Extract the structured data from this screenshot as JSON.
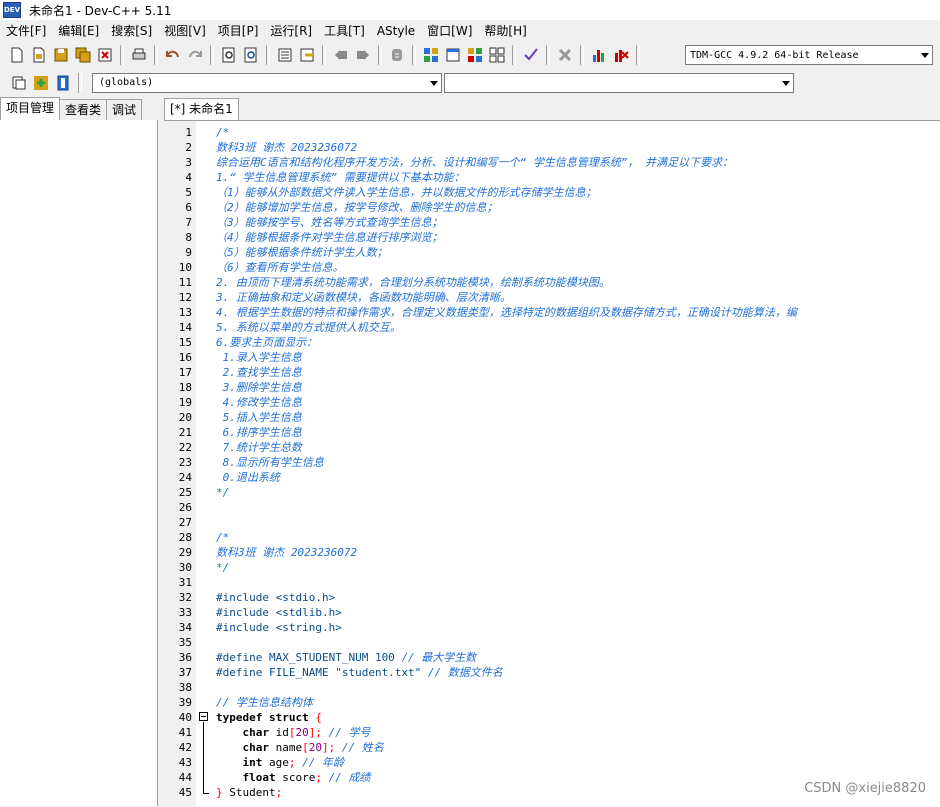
{
  "window": {
    "title": "未命名1 - Dev-C++ 5.11",
    "icon_text": "DEV"
  },
  "menu": [
    "文件[F]",
    "编辑[E]",
    "搜索[S]",
    "视图[V]",
    "项目[P]",
    "运行[R]",
    "工具[T]",
    "AStyle",
    "窗口[W]",
    "帮助[H]"
  ],
  "compiler": {
    "selected": "TDM-GCC 4.9.2 64-bit Release"
  },
  "scope_combo": {
    "selected": "(globals)"
  },
  "symbol_combo": {
    "selected": ""
  },
  "left_tabs": [
    "项目管理",
    "查看类",
    "调试"
  ],
  "editor_tab": "[*] 未命名1",
  "code_lines": [
    [
      [
        "cmt",
        "/*"
      ]
    ],
    [
      [
        "cmt",
        "数科3班 谢杰 2023236072"
      ]
    ],
    [
      [
        "cmt",
        "综合运用C语言和结构化程序开发方法，分析、设计和编写一个“ 学生信息管理系统”， 并满足以下要求："
      ]
    ],
    [
      [
        "cmt",
        "1.“ 学生信息管理系统” 需要提供以下基本功能："
      ]
    ],
    [
      [
        "cmt",
        "（1）能够从外部数据文件读入学生信息，并以数据文件的形式存储学生信息；"
      ]
    ],
    [
      [
        "cmt",
        "（2）能够增加学生信息，按学号修改、删除学生的信息；"
      ]
    ],
    [
      [
        "cmt",
        "（3）能够按学号、姓名等方式查询学生信息；"
      ]
    ],
    [
      [
        "cmt",
        "（4）能够根据条件对学生信息进行排序浏览；"
      ]
    ],
    [
      [
        "cmt",
        "（5）能够根据条件统计学生人数；"
      ]
    ],
    [
      [
        "cmt",
        "（6）查看所有学生信息。"
      ]
    ],
    [
      [
        "cmt",
        "2. 由顶而下理清系统功能需求，合理划分系统功能模块，绘制系统功能模块图。"
      ]
    ],
    [
      [
        "cmt",
        "3. 正确抽象和定义函数模块，各函数功能明确、层次清晰。"
      ]
    ],
    [
      [
        "cmt",
        "4. 根据学生数据的特点和操作需求，合理定义数据类型，选择特定的数据组织及数据存储方式，正确设计功能算法，编"
      ]
    ],
    [
      [
        "cmt",
        "5. 系统以菜单的方式提供人机交互。"
      ]
    ],
    [
      [
        "cmt",
        "6.要求主页面显示："
      ]
    ],
    [
      [
        "cmt",
        " 1.录入学生信息"
      ]
    ],
    [
      [
        "cmt",
        " 2.查找学生信息"
      ]
    ],
    [
      [
        "cmt",
        " 3.删除学生信息"
      ]
    ],
    [
      [
        "cmt",
        " 4.修改学生信息"
      ]
    ],
    [
      [
        "cmt",
        " 5.插入学生信息"
      ]
    ],
    [
      [
        "cmt",
        " 6.排序学生信息"
      ]
    ],
    [
      [
        "cmt",
        " 7.统计学生总数"
      ]
    ],
    [
      [
        "cmt",
        " 8.显示所有学生信息"
      ]
    ],
    [
      [
        "cmt",
        " 0.退出系统"
      ]
    ],
    [
      [
        "cmt",
        "*/"
      ]
    ],
    [],
    [],
    [
      [
        "cmt",
        "/*"
      ]
    ],
    [
      [
        "cmt",
        "数科3班 谢杰 2023236072"
      ]
    ],
    [
      [
        "cmt",
        "*/"
      ]
    ],
    [],
    [
      [
        "pp",
        "#include <stdio.h>"
      ]
    ],
    [
      [
        "pp",
        "#include <stdlib.h>"
      ]
    ],
    [
      [
        "pp",
        "#include <string.h>"
      ]
    ],
    [],
    [
      [
        "pp",
        "#define MAX_STUDENT_NUM 100 "
      ],
      [
        "cmt",
        "// 最大学生数"
      ]
    ],
    [
      [
        "pp",
        "#define FILE_NAME \"student.txt\" "
      ],
      [
        "cmt",
        "// 数据文件名"
      ]
    ],
    [],
    [
      [
        "cmt",
        "// 学生信息结构体"
      ]
    ],
    [
      [
        "kw",
        "typedef struct "
      ],
      [
        "pn",
        "{"
      ]
    ],
    [
      [
        "txt",
        "    "
      ],
      [
        "kw",
        "char "
      ],
      [
        "txt",
        "id"
      ],
      [
        "pn",
        "["
      ],
      [
        "num",
        "20"
      ],
      [
        "pn",
        "];"
      ],
      [
        "txt",
        " "
      ],
      [
        "cmt",
        "// 学号"
      ]
    ],
    [
      [
        "txt",
        "    "
      ],
      [
        "kw",
        "char "
      ],
      [
        "txt",
        "name"
      ],
      [
        "pn",
        "["
      ],
      [
        "num",
        "20"
      ],
      [
        "pn",
        "];"
      ],
      [
        "txt",
        " "
      ],
      [
        "cmt",
        "// 姓名"
      ]
    ],
    [
      [
        "txt",
        "    "
      ],
      [
        "kw",
        "int "
      ],
      [
        "txt",
        "age"
      ],
      [
        "pn",
        ";"
      ],
      [
        "txt",
        " "
      ],
      [
        "cmt",
        "// 年龄"
      ]
    ],
    [
      [
        "txt",
        "    "
      ],
      [
        "kw",
        "float "
      ],
      [
        "txt",
        "score"
      ],
      [
        "pn",
        ";"
      ],
      [
        "txt",
        " "
      ],
      [
        "cmt",
        "// 成绩"
      ]
    ],
    [
      [
        "pn",
        "} "
      ],
      [
        "txt",
        "Student"
      ],
      [
        "pn",
        ";"
      ]
    ]
  ],
  "watermark": "CSDN @xiejie8820"
}
